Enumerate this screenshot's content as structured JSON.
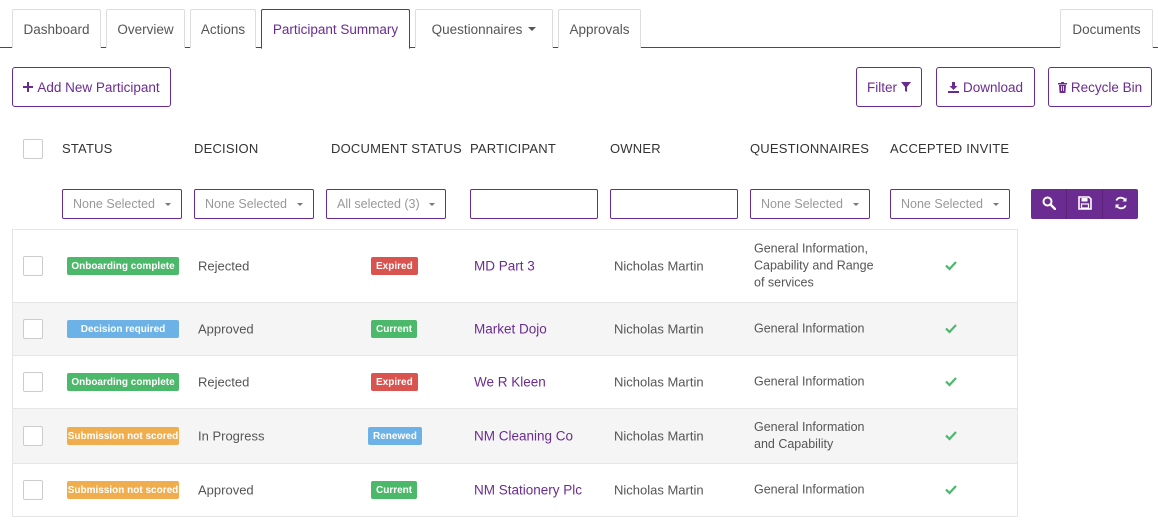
{
  "tabs": [
    {
      "label": "Dashboard"
    },
    {
      "label": "Overview"
    },
    {
      "label": "Actions"
    },
    {
      "label": "Participant Summary",
      "active": true
    },
    {
      "label": "Questionnaires",
      "dropdown": true
    },
    {
      "label": "Approvals"
    },
    {
      "label": "Documents"
    }
  ],
  "toolbar": {
    "add_label": "Add New Participant",
    "filter_label": "Filter",
    "download_label": "Download",
    "recycle_label": "Recycle Bin"
  },
  "columns": [
    "STATUS",
    "DECISION",
    "DOCUMENT STATUS",
    "PARTICIPANT",
    "OWNER",
    "QUESTIONNAIRES",
    "ACCEPTED INVITE"
  ],
  "filters": {
    "status": "None Selected",
    "decision": "None Selected",
    "document_status": "All selected (3)",
    "participant": "",
    "owner": "",
    "questionnaires": "None Selected",
    "accepted_invite": "None Selected"
  },
  "rows": [
    {
      "status": "Onboarding complete",
      "status_color": "#4cb86a",
      "decision": "Rejected",
      "doc_status": "Expired",
      "doc_color": "#d9534f",
      "participant": "MD Part 3",
      "owner": "Nicholas Martin",
      "questionnaires": [
        "General Information,",
        "Capability and Range",
        "of services"
      ],
      "accepted": true
    },
    {
      "status": "Decision required",
      "status_color": "#6cb2e6",
      "decision": "Approved",
      "doc_status": "Current",
      "doc_color": "#4cb86a",
      "participant": "Market Dojo",
      "owner": "Nicholas Martin",
      "questionnaires": [
        "General Information"
      ],
      "accepted": true
    },
    {
      "status": "Onboarding complete",
      "status_color": "#4cb86a",
      "decision": "Rejected",
      "doc_status": "Expired",
      "doc_color": "#d9534f",
      "participant": "We R Kleen",
      "owner": "Nicholas Martin",
      "questionnaires": [
        "General Information"
      ],
      "accepted": true
    },
    {
      "status": "Submission not scored",
      "status_color": "#f0ad4e",
      "decision": "In Progress",
      "doc_status": "Renewed",
      "doc_color": "#6cb2e6",
      "participant": "NM Cleaning Co",
      "owner": "Nicholas Martin",
      "questionnaires": [
        "General Information",
        "and Capability"
      ],
      "accepted": true
    },
    {
      "status": "Submission not scored",
      "status_color": "#f0ad4e",
      "decision": "Approved",
      "doc_status": "Current",
      "doc_color": "#4cb86a",
      "participant": "NM Stationery Plc",
      "owner": "Nicholas Martin",
      "questionnaires": [
        "General Information"
      ],
      "accepted": true
    }
  ],
  "colors": {
    "accent": "#6b2c91",
    "tick": "#4cb86a"
  },
  "icons": {
    "add": "plus-icon",
    "filter": "funnel-icon",
    "download": "download-icon",
    "recycle": "trash-icon",
    "search": "search-icon",
    "save": "save-icon",
    "refresh": "refresh-icon",
    "accepted": "check-icon"
  }
}
